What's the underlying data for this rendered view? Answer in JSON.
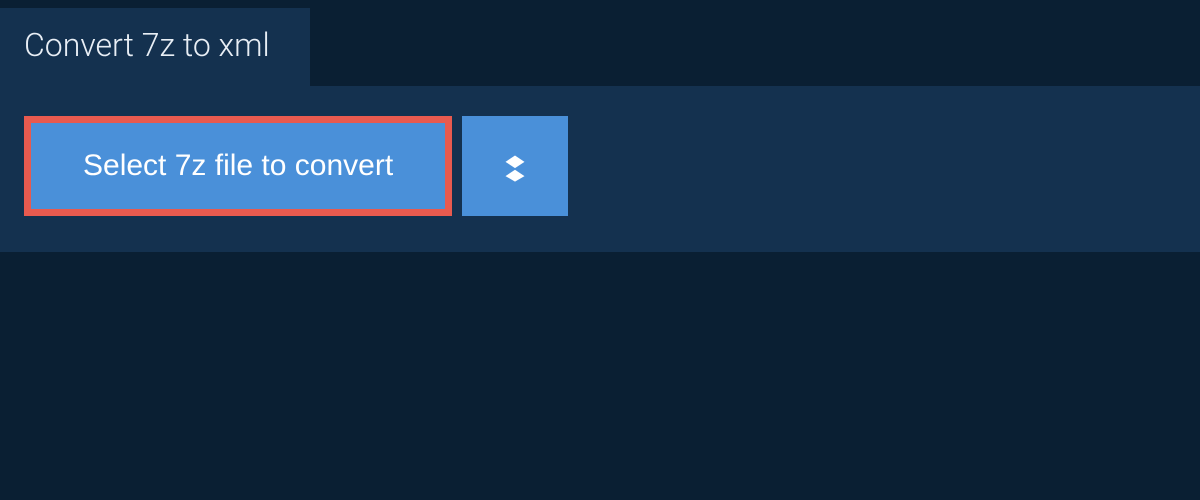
{
  "header": {
    "tab_label": "Convert 7z to xml"
  },
  "actions": {
    "select_file_label": "Select 7z file to convert"
  }
}
